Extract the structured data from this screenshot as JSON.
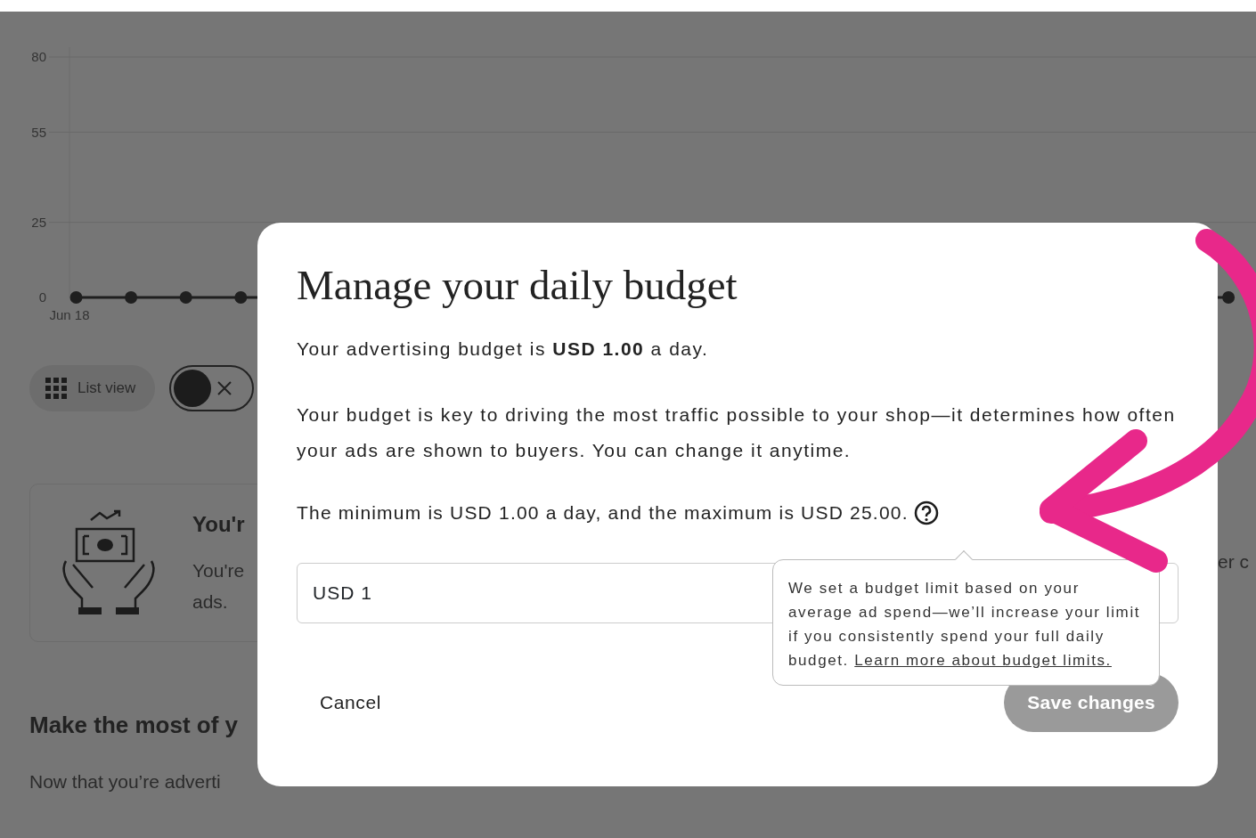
{
  "chart": {
    "chart_data": {
      "type": "line",
      "ylim": [
        0,
        80
      ],
      "yticks": [
        0,
        25,
        55,
        80
      ],
      "series": [
        {
          "color": "#1f1f1f",
          "marker": "circle",
          "values": [
            0,
            0,
            0,
            0,
            null,
            null,
            null,
            null,
            null,
            null,
            null,
            null,
            null,
            null,
            null,
            null,
            null,
            null,
            null,
            null,
            null,
            0
          ]
        }
      ]
    },
    "start_date": "Jun 18"
  },
  "view_toggle": {
    "label": "List view",
    "on": false
  },
  "card": {
    "title": "You'r",
    "text": [
      "You're",
      "ads."
    ]
  },
  "section": {
    "title": "Make the most of y",
    "text": "Now that you’re adverti"
  },
  "right_fragment": "er c",
  "dialog": {
    "title": "Manage your daily budget",
    "paragraphs": [
      "Your advertising budget is **USD 1.00** a day.",
      "Your budget is key to driving the most traffic possible to your shop—it determines how often your ads are shown to buyers. You can change it anytime."
    ],
    "limits": "The minimum is USD 1.00 a day, and the maximum is USD 25.00.",
    "budget_value": "USD 1",
    "tooltip": {
      "text": "We set a budget limit based on your average ad spend—we’ll increase your limit if you consistently spend your full daily budget.",
      "link": "Learn more about budget limits."
    },
    "cancel": "Cancel",
    "save": {
      "label": "Save changes",
      "disabled": true
    }
  }
}
